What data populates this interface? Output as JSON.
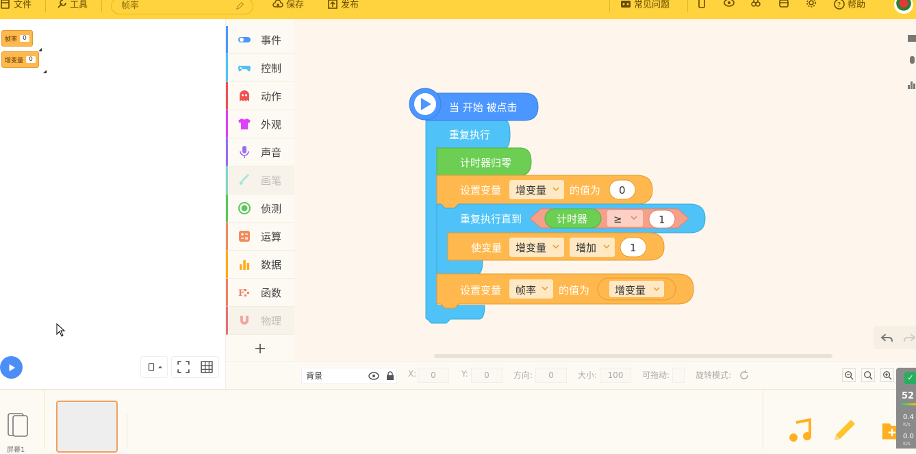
{
  "topbar": {
    "file": "文件",
    "tools": "工具",
    "project_name": "帧率",
    "save": "保存",
    "publish": "发布",
    "faq": "常见问题",
    "help": "帮助"
  },
  "monitors": [
    {
      "name": "帧率",
      "value": "0"
    },
    {
      "name": "增变量",
      "value": "0"
    }
  ],
  "categories": [
    {
      "label": "事件",
      "color": "#4c97ff",
      "enabled": true
    },
    {
      "label": "控制",
      "color": "#4fc3f7",
      "enabled": true
    },
    {
      "label": "动作",
      "color": "#ef5350",
      "enabled": true
    },
    {
      "label": "外观",
      "color": "#e040fb",
      "enabled": true
    },
    {
      "label": "声音",
      "color": "#9c6cf2",
      "enabled": true
    },
    {
      "label": "画笔",
      "color": "#7fd8c8",
      "enabled": false
    },
    {
      "label": "侦测",
      "color": "#5cc85c",
      "enabled": true
    },
    {
      "label": "运算",
      "color": "#f28c5b",
      "enabled": true
    },
    {
      "label": "数据",
      "color": "#ffab19",
      "enabled": true
    },
    {
      "label": "函数",
      "color": "#f08060",
      "enabled": true
    },
    {
      "label": "物理",
      "color": "#e57373",
      "enabled": false
    }
  ],
  "blocks": {
    "hat": "当 开始 被点击",
    "forever": "重复执行",
    "reset_timer": "计时器归零",
    "set_var1_prefix": "设置变量",
    "set_var1_var": "增变量",
    "set_var1_mid": "的值为",
    "set_var1_value": "0",
    "repeat_until": "重复执行直到",
    "timer": "计时器",
    "op": "≥",
    "op_value": "1",
    "change_prefix": "使变量",
    "change_var": "增变量",
    "change_op": "增加",
    "change_value": "1",
    "set_var2_prefix": "设置变量",
    "set_var2_var": "帧率",
    "set_var2_mid": "的值为",
    "set_var2_reporter": "增变量"
  },
  "sprite_props": {
    "name": "背景",
    "x_label": "X:",
    "x": "0",
    "y_label": "Y:",
    "y": "0",
    "dir_label": "方向:",
    "dir": "0",
    "size_label": "大小:",
    "size": "100",
    "drag_label": "可拖动:",
    "rotate_label": "旋转模式:"
  },
  "screen_label": "屏幕1",
  "perf": {
    "value": "52",
    "a": "0.4",
    "b": "0.0",
    "unit": "K/s"
  }
}
